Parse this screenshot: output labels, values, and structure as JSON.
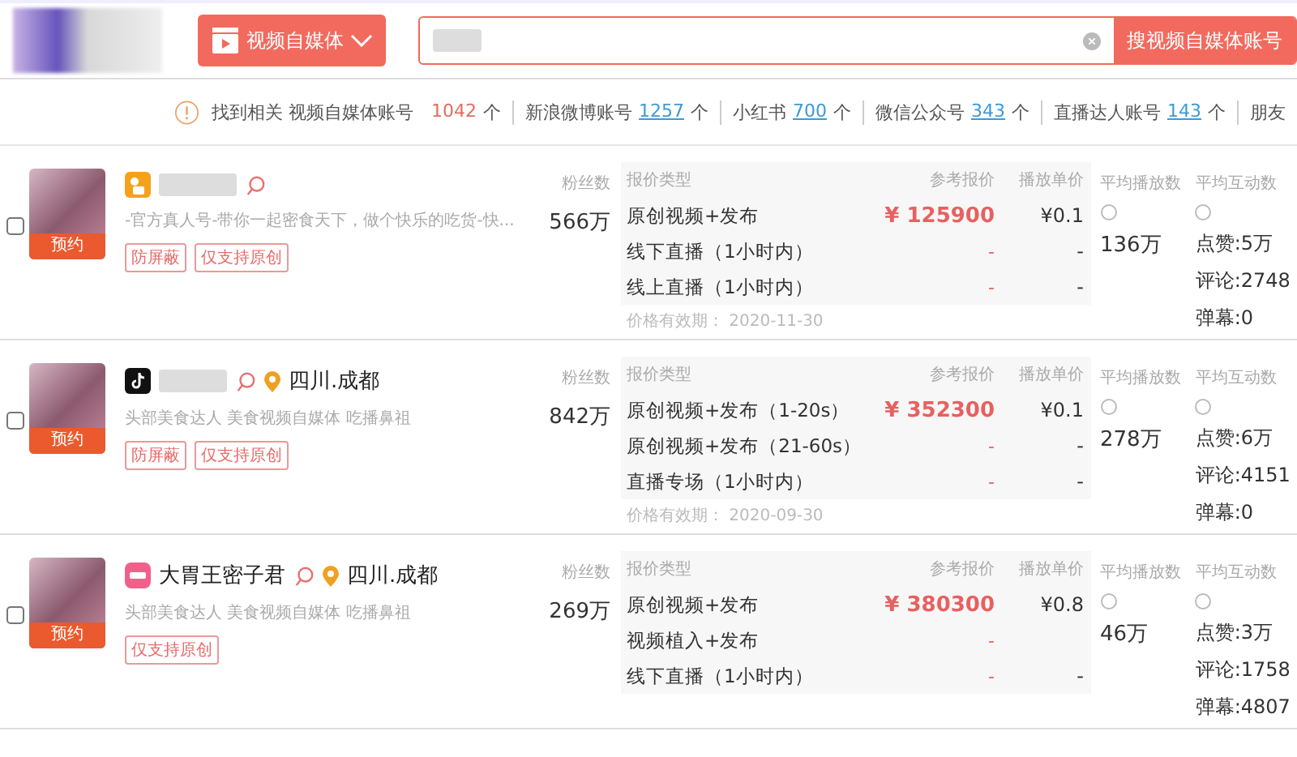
{
  "header": {
    "category_button": "视频自媒体",
    "search_button": "搜视频自媒体账号"
  },
  "stats": {
    "prefix": "找到相关 视频自媒体账号",
    "items": [
      {
        "count": "1042",
        "unit": "个",
        "kind": "total"
      },
      {
        "label": "新浪微博账号",
        "count": "1257",
        "unit": "个",
        "kind": "link"
      },
      {
        "label": "小红书",
        "count": "700",
        "unit": "个",
        "kind": "link"
      },
      {
        "label": "微信公众号",
        "count": "343",
        "unit": "个",
        "kind": "link"
      },
      {
        "label": "直播达人账号",
        "count": "143",
        "unit": "个",
        "kind": "link"
      },
      {
        "label": "朋友",
        "kind": "label"
      }
    ]
  },
  "accounts": [
    {
      "checked": false,
      "badge": "预约",
      "kind": "kuaishou",
      "description": "-官方真人号-带你一起密食天下，做个快乐的吃货-快...",
      "tags": [
        "防屏蔽",
        "仅支持原创"
      ],
      "fans_label": "粉丝数",
      "fans": "566万",
      "price_headers": [
        "报价类型",
        "参考报价",
        "播放单价"
      ],
      "prices": [
        {
          "type": "原创视频+发布",
          "price": "¥ 125900",
          "unit_price": "¥0.1"
        },
        {
          "type": "线下直播（1小时内）",
          "price": "-",
          "unit_price": "-"
        },
        {
          "type": "线上直播（1小时内）",
          "price": "-",
          "unit_price": "-"
        }
      ],
      "valid": "价格有效期：  2020-11-30",
      "avg_play_label": "平均播放数",
      "avg_play": "136万",
      "avg_interact_label": "平均互动数",
      "interactions": [
        "点赞:5万",
        "评论:2748",
        "弹幕:0"
      ]
    },
    {
      "checked": false,
      "badge": "预约",
      "kind": "douyin",
      "location": "四川.成都",
      "description": "头部美食达人 美食视频自媒体 吃播鼻祖",
      "tags": [
        "防屏蔽",
        "仅支持原创"
      ],
      "fans_label": "粉丝数",
      "fans": "842万",
      "price_headers": [
        "报价类型",
        "参考报价",
        "播放单价"
      ],
      "prices": [
        {
          "type": "原创视频+发布（1-20s）",
          "price": "¥ 352300",
          "unit_price": "¥0.1"
        },
        {
          "type": "原创视频+发布（21-60s）",
          "price": "-",
          "unit_price": "-"
        },
        {
          "type": "直播专场（1小时内）",
          "price": "-",
          "unit_price": "-"
        }
      ],
      "valid": "价格有效期：  2020-09-30",
      "avg_play_label": "平均播放数",
      "avg_play": "278万",
      "avg_interact_label": "平均互动数",
      "interactions": [
        "点赞:6万",
        "评论:4151",
        "弹幕:0"
      ]
    },
    {
      "checked": false,
      "badge": "预约",
      "kind": "xiaohongshu",
      "name": "大胃王密子君",
      "location": "四川.成都",
      "description": "头部美食达人 美食视频自媒体 吃播鼻祖",
      "tags": [
        "仅支持原创"
      ],
      "fans_label": "粉丝数",
      "fans": "269万",
      "price_headers": [
        "报价类型",
        "参考报价",
        "播放单价"
      ],
      "prices": [
        {
          "type": "原创视频+发布",
          "price": "¥ 380300",
          "unit_price": "¥0.8"
        },
        {
          "type": "视频植入+发布",
          "price": "-"
        },
        {
          "type": "线下直播（1小时内）",
          "price": "-",
          "unit_price": "-"
        }
      ],
      "avg_play_label": "平均播放数",
      "avg_play": "46万",
      "avg_interact_label": "平均互动数",
      "interactions": [
        "点赞:3万",
        "评论:1758",
        "弹幕:4807"
      ]
    }
  ]
}
